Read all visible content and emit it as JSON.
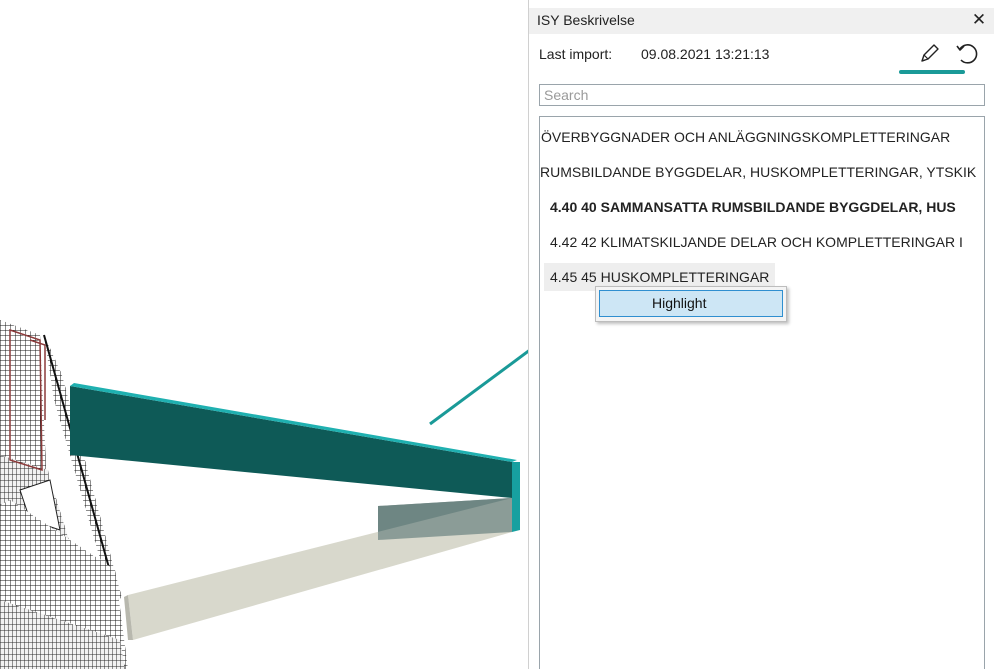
{
  "panel": {
    "title": "ISY Beskrivelse",
    "close_glyph": "✕",
    "import_label": "Last import:",
    "import_value": "09.08.2021 13:21:13",
    "tools": [
      "pencil-icon",
      "undo-icon"
    ],
    "accent_color": "#1a9a98",
    "search_placeholder": "Search",
    "tree_items": [
      {
        "label": "ÖVERBYGGNADER OCH ANLÄGGNINGSKOMPLETTERINGAR",
        "bold": false
      },
      {
        "label": "RUMSBILDANDE BYGGDELAR, HUSKOMPLETTERINGAR, YTSKIK",
        "bold": false
      },
      {
        "label": "4.40 40 SAMMANSATTA RUMSBILDANDE BYGGDELAR, HUS",
        "bold": true
      },
      {
        "label": "4.42 42 KLIMATSKILJANDE DELAR OCH KOMPLETTERINGAR I",
        "bold": false
      },
      {
        "label": "4.45 45 HUSKOMPLETTERINGAR",
        "bold": false,
        "selected": true
      }
    ]
  },
  "context_menu": {
    "items": [
      "Highlight"
    ]
  },
  "model": {
    "highlight_color": "#0e5a57",
    "edge_color": "#1fb0b0"
  }
}
